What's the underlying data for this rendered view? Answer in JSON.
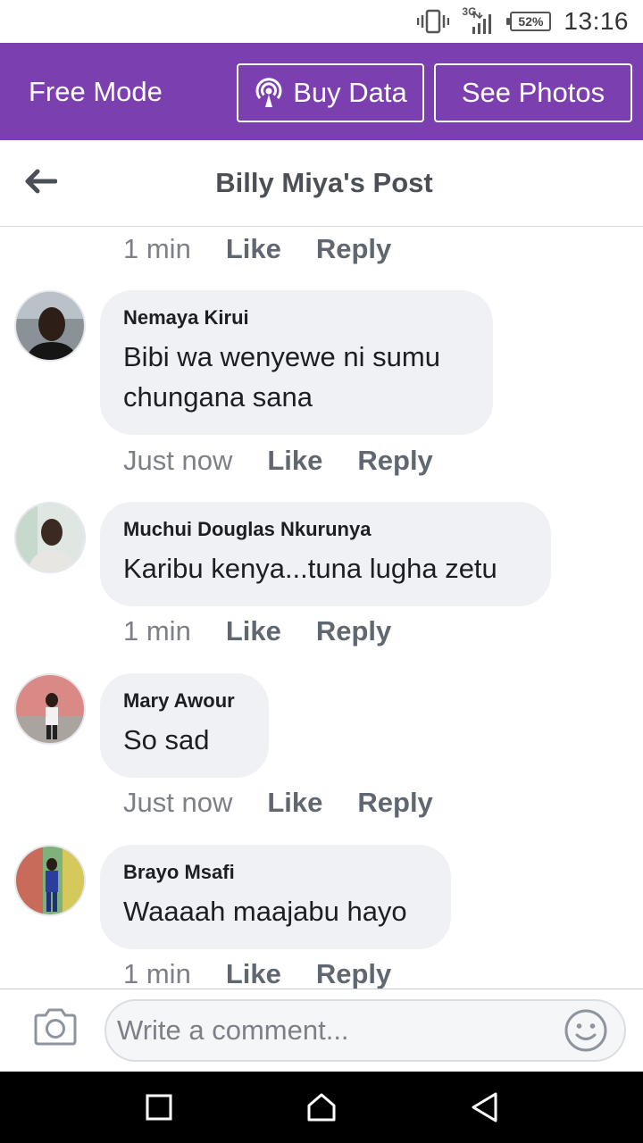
{
  "status_bar": {
    "network": "3G",
    "battery": "52%",
    "time": "13:16"
  },
  "free_mode_bar": {
    "label": "Free Mode",
    "buy_data_label": "Buy Data",
    "see_photos_label": "See Photos",
    "bg_color": "#7b3fb0"
  },
  "header": {
    "title": "Billy Miya's Post"
  },
  "top_meta": {
    "time": "1 min",
    "like": "Like",
    "reply": "Reply"
  },
  "comments": [
    {
      "author": "Nemaya Kirui",
      "text": "Bibi wa wenyewe ni sumu chungana sana",
      "time": "Just now",
      "like": "Like",
      "reply": "Reply"
    },
    {
      "author": "Muchui Douglas Nkurunya",
      "text": "Karibu kenya...tuna lugha zetu",
      "time": "1 min",
      "like": "Like",
      "reply": "Reply"
    },
    {
      "author": "Mary Awour",
      "text": "So sad",
      "time": "Just now",
      "like": "Like",
      "reply": "Reply"
    },
    {
      "author": "Brayo Msafi",
      "text": "Waaaah maajabu hayo",
      "time": "1 min",
      "like": "Like",
      "reply": "Reply"
    }
  ],
  "composer": {
    "placeholder": "Write a comment..."
  },
  "icons": {
    "vibrate": "vibrate-icon",
    "signal": "signal-icon",
    "battery": "battery-icon",
    "broadcast": "broadcast-icon",
    "back": "back-arrow-icon",
    "camera": "camera-icon",
    "emoji": "emoji-icon",
    "nav_recents": "recents-square-icon",
    "nav_home": "home-icon",
    "nav_back": "back-triangle-icon"
  }
}
